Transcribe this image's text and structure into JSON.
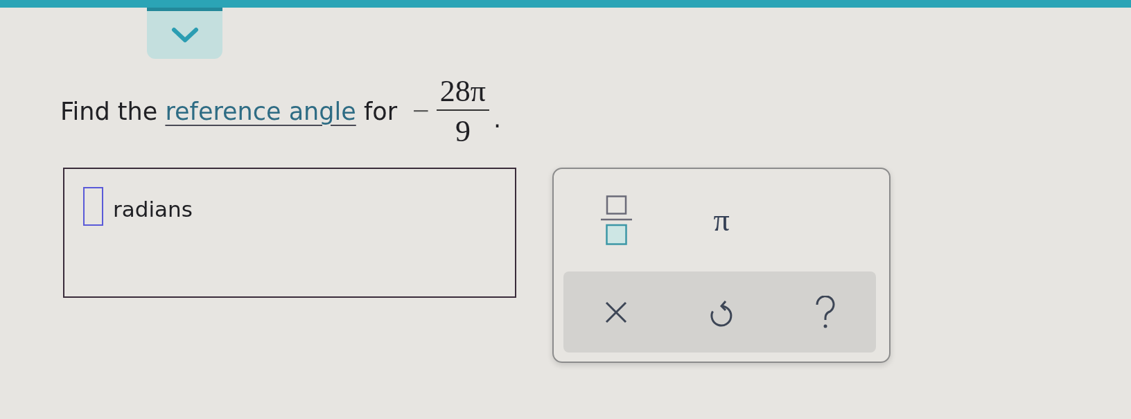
{
  "question": {
    "prefix": "Find the",
    "link": "reference angle",
    "suffix": "for",
    "expression": {
      "sign": "−",
      "numerator": "28π",
      "denominator": "9"
    },
    "end_mark": "."
  },
  "answer": {
    "unit": "radians"
  },
  "keypad": {
    "keys": [
      {
        "kind": "fraction"
      },
      {
        "kind": "symbol",
        "label": "π"
      }
    ],
    "actions": [
      {
        "kind": "clear"
      },
      {
        "kind": "undo"
      },
      {
        "kind": "help"
      }
    ]
  }
}
